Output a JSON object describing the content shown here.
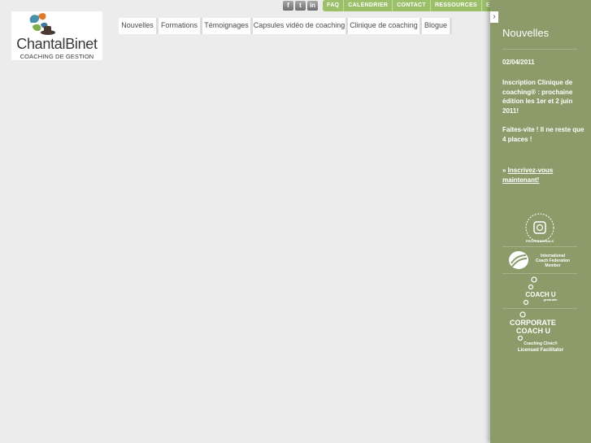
{
  "logo": {
    "brand": "ChantalBinet",
    "tagline": "COACHING DE GESTION"
  },
  "social": [
    {
      "label": "f",
      "icon": "facebook-icon"
    },
    {
      "label": "t",
      "icon": "twitter-icon"
    },
    {
      "label": "in",
      "icon": "linkedin-icon"
    }
  ],
  "topbar": {
    "links": [
      "FAQ",
      "CALENDRIER",
      "CONTACT",
      "RESSOURCES",
      "ENGLISH"
    ]
  },
  "nav": {
    "items": [
      "Nouvelles",
      "Formations",
      "Témoignages",
      "Capsules vidéo de coaching",
      "Clinique de coaching",
      "Blogue"
    ]
  },
  "sidebar": {
    "collapse_glyph": "›",
    "title": "Nouvelles",
    "date": "02/04/2011",
    "headline": "Inscription Clinique de coaching® : prochaine édition les 1er et 2 juin 2011!",
    "urgency": "Faites-vite ! Il ne reste que 4 places !",
    "cta_prefix": "» ",
    "cta_link": "Inscrivez-vous maintenant!",
    "badges": {
      "ranking": "PROFESSIONALS",
      "icf_line1": "International",
      "icf_line2": "Coach Federation",
      "icf_line3": "Member",
      "coachu": "COACH U",
      "coachu_sub": "graduate",
      "corporate_line1": "CORPORATE",
      "corporate_line2": "COACH U",
      "corporate_line3": "Coaching Clinic®",
      "corporate_line4": "Licensed Facilitator"
    }
  },
  "colors": {
    "sidebar_bg": "#8c9b69",
    "topbar_bg": "#9cc06a",
    "page_bg": "#ececec"
  }
}
